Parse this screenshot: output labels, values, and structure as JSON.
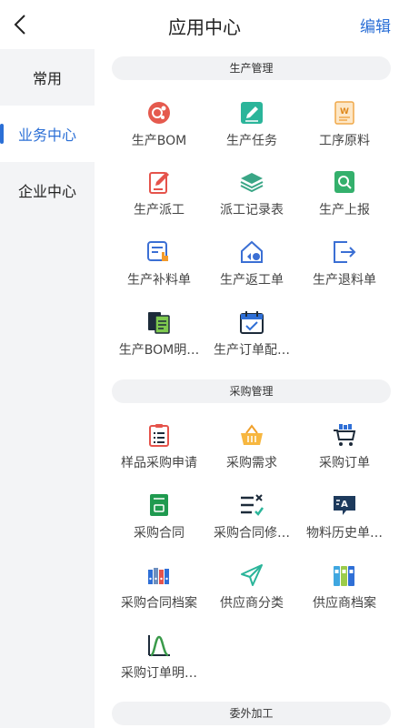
{
  "header": {
    "title": "应用中心",
    "edit_label": "编辑"
  },
  "sidebar": {
    "items": [
      {
        "label": "常用"
      },
      {
        "label": "业务中心"
      },
      {
        "label": "企业中心"
      }
    ]
  },
  "sections": [
    {
      "title": "生产管理",
      "apps": [
        {
          "label": "生产BOM",
          "icon": "gear-circle-icon"
        },
        {
          "label": "生产任务",
          "icon": "edit-note-icon"
        },
        {
          "label": "工序原料",
          "icon": "word-document-icon"
        },
        {
          "label": "生产派工",
          "icon": "pencil-doc-icon"
        },
        {
          "label": "派工记录表",
          "icon": "layers-icon"
        },
        {
          "label": "生产上报",
          "icon": "search-document-icon"
        },
        {
          "label": "生产补料单",
          "icon": "form-touch-icon"
        },
        {
          "label": "生产返工单",
          "icon": "home-return-icon"
        },
        {
          "label": "生产退料单",
          "icon": "exit-box-icon"
        },
        {
          "label": "生产BOM明…",
          "icon": "stacked-docs-icon"
        },
        {
          "label": "生产订单配…",
          "icon": "calendar-icon"
        }
      ]
    },
    {
      "title": "采购管理",
      "apps": [
        {
          "label": "样品采购申请",
          "icon": "clipboard-list-icon"
        },
        {
          "label": "采购需求",
          "icon": "basket-icon"
        },
        {
          "label": "采购订单",
          "icon": "cart-icon"
        },
        {
          "label": "采购合同",
          "icon": "contract-icon"
        },
        {
          "label": "采购合同修…",
          "icon": "checklist-icon"
        },
        {
          "label": "物料历史单…",
          "icon": "text-translate-icon"
        },
        {
          "label": "采购合同档案",
          "icon": "binders-icon"
        },
        {
          "label": "供应商分类",
          "icon": "send-icon"
        },
        {
          "label": "供应商档案",
          "icon": "folders-icon"
        },
        {
          "label": "采购订单明…",
          "icon": "bell-curve-icon"
        }
      ]
    },
    {
      "title": "委外加工",
      "apps": []
    }
  ]
}
